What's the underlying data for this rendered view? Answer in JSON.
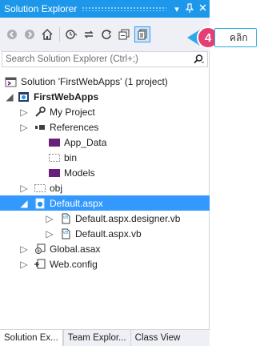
{
  "window": {
    "title": "Solution Explorer",
    "pin_label": "▾",
    "pin_icon": "pin-icon",
    "close_icon": "close-icon"
  },
  "toolbar": {
    "buttons": [
      "back-icon",
      "forward-icon",
      "home-icon",
      "history-icon",
      "sync-icon",
      "refresh-icon",
      "collapse-all-icon",
      "show-all-files-icon"
    ]
  },
  "search": {
    "placeholder": "Search Solution Explorer (Ctrl+;)"
  },
  "tree": {
    "items": [
      {
        "label": "Solution 'FirstWebApps' (1 project)",
        "icon": "solution-icon"
      },
      {
        "label": "FirstWebApps",
        "icon": "web-project-icon"
      },
      {
        "label": "My Project",
        "icon": "wrench-icon"
      },
      {
        "label": "References",
        "icon": "references-icon"
      },
      {
        "label": "App_Data",
        "icon": "folder-icon"
      },
      {
        "label": "bin",
        "icon": "dashed-folder-icon"
      },
      {
        "label": "Models",
        "icon": "folder-icon"
      },
      {
        "label": "obj",
        "icon": "dashed-folder-icon"
      },
      {
        "label": "Default.aspx",
        "icon": "web-page-icon"
      },
      {
        "label": "Default.aspx.designer.vb",
        "icon": "vb-file-icon"
      },
      {
        "label": "Default.aspx.vb",
        "icon": "vb-file-icon"
      },
      {
        "label": "Global.asax",
        "icon": "global-asax-icon"
      },
      {
        "label": "Web.config",
        "icon": "config-icon"
      }
    ]
  },
  "tabs": [
    {
      "label": "Solution Ex..."
    },
    {
      "label": "Team Explor..."
    },
    {
      "label": "Class View"
    }
  ],
  "callout": {
    "step": "4",
    "text": "คลิก"
  },
  "colors": {
    "titlebar": "#1c97ea",
    "selected": "#3399ff",
    "badge": "#e53e75",
    "arrow": "#29a9e6"
  }
}
